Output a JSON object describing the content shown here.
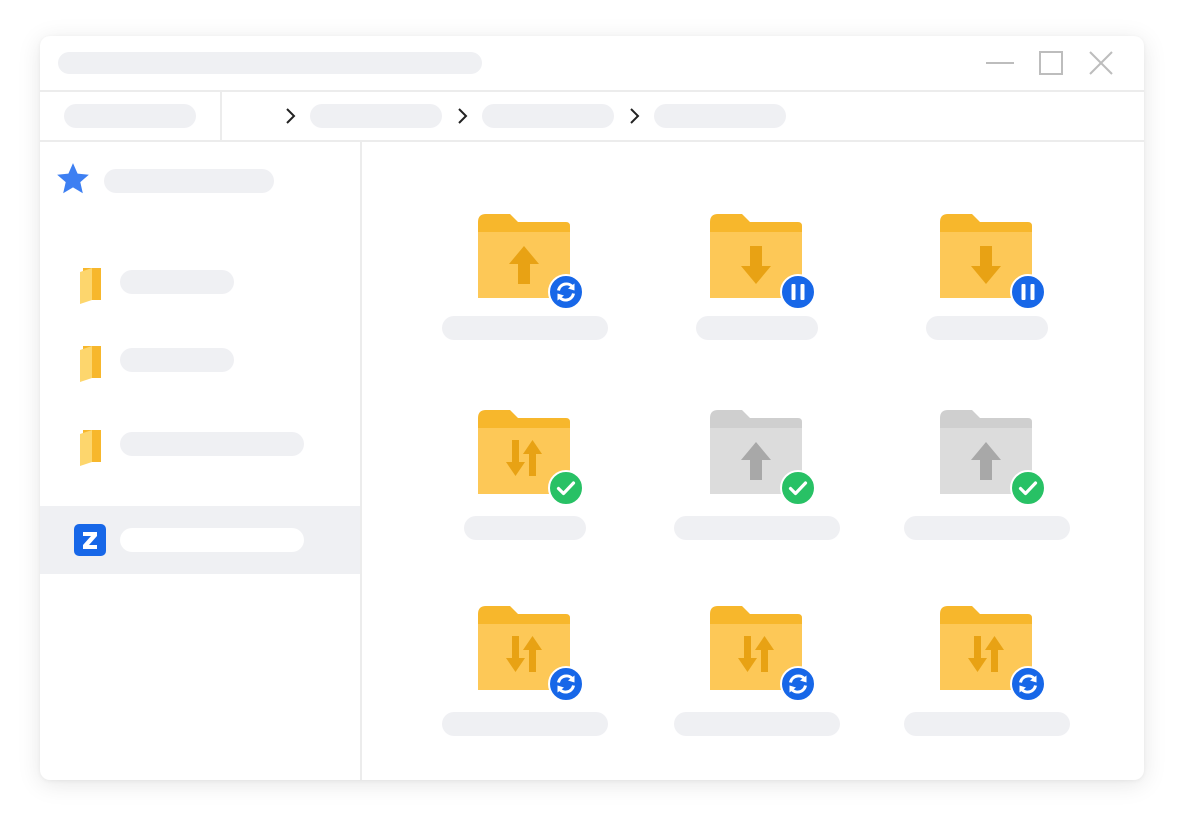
{
  "window": {
    "title": "",
    "controls": [
      "minimize-icon",
      "maximize-icon",
      "close-icon"
    ]
  },
  "navbar": {
    "location": "",
    "breadcrumb": [
      "",
      "",
      ""
    ],
    "separator_icon": "chevron-right-icon"
  },
  "sidebar": {
    "items": [
      {
        "label": "",
        "icon": "star-icon",
        "active": false
      },
      {
        "label": "",
        "icon": "folder-icon",
        "active": false
      },
      {
        "label": "",
        "icon": "folder-icon",
        "active": false
      },
      {
        "label": "",
        "icon": "folder-icon",
        "active": false
      },
      {
        "label": "",
        "icon": "zoolz-logo-icon",
        "active": true
      }
    ]
  },
  "folders": [
    {
      "name": "",
      "folder_state": "active",
      "transfer": "upload",
      "status": "syncing"
    },
    {
      "name": "",
      "folder_state": "active",
      "transfer": "download",
      "status": "paused"
    },
    {
      "name": "",
      "folder_state": "active",
      "transfer": "download",
      "status": "paused"
    },
    {
      "name": "",
      "folder_state": "active",
      "transfer": "two-way",
      "status": "completed"
    },
    {
      "name": "",
      "folder_state": "inactive",
      "transfer": "upload",
      "status": "completed"
    },
    {
      "name": "",
      "folder_state": "inactive",
      "transfer": "upload",
      "status": "completed"
    },
    {
      "name": "",
      "folder_state": "active",
      "transfer": "two-way",
      "status": "syncing"
    },
    {
      "name": "",
      "folder_state": "active",
      "transfer": "two-way",
      "status": "syncing"
    },
    {
      "name": "",
      "folder_state": "active",
      "transfer": "two-way",
      "status": "syncing"
    }
  ],
  "colors": {
    "folder_back": "#f7b72c",
    "folder_front": "#fdc857",
    "arrow_active": "#e8a214",
    "folder_back_inactive": "#cfcfcf",
    "folder_front_inactive": "#dcdcdc",
    "arrow_inactive": "#a8a8a8",
    "badge_blue": "#1767e8",
    "badge_green": "#28c165",
    "star_blue": "#3d7ff2",
    "placeholder": "#eff0f3"
  }
}
